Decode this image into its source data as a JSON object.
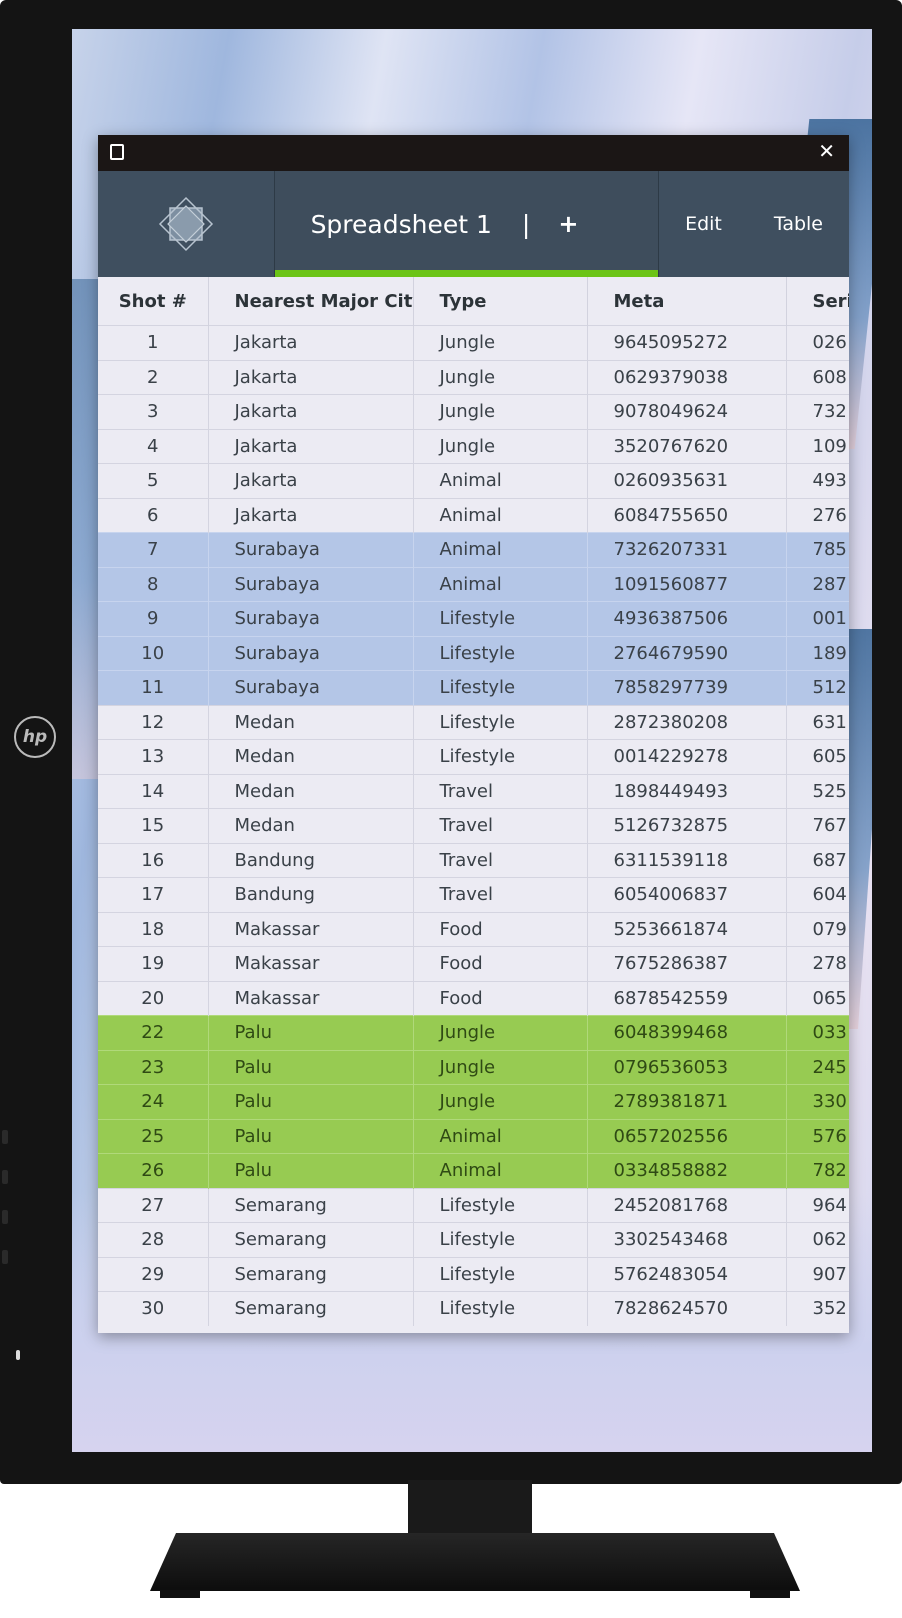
{
  "brand": {
    "logo_text": "hp"
  },
  "window": {
    "titlebar": {
      "maximize_icon": "square-icon",
      "close_icon": "close-icon",
      "close_label": "✕"
    },
    "app_logo_icon": "geometric-star-logo",
    "tab": {
      "title": "Spreadsheet 1",
      "separator": "|",
      "add": "+",
      "active_color": "#6cc417"
    },
    "menu": [
      "Edit",
      "Table"
    ]
  },
  "colors": {
    "header_bg": "#3f4f5f",
    "row_bg": "#ecebf3",
    "highlight_blue": "#b4c6e7",
    "highlight_green": "#97cb52"
  },
  "table": {
    "columns": [
      "Shot #",
      "Nearest Major City",
      "Type",
      "Meta",
      "Seri"
    ],
    "rows": [
      {
        "shot": "1",
        "city": "Jakarta",
        "type": "Jungle",
        "meta": "9645095272",
        "serial": "026",
        "hl": ""
      },
      {
        "shot": "2",
        "city": "Jakarta",
        "type": "Jungle",
        "meta": "0629379038",
        "serial": "608",
        "hl": ""
      },
      {
        "shot": "3",
        "city": "Jakarta",
        "type": "Jungle",
        "meta": "9078049624",
        "serial": "732",
        "hl": ""
      },
      {
        "shot": "4",
        "city": "Jakarta",
        "type": "Jungle",
        "meta": "3520767620",
        "serial": "109",
        "hl": ""
      },
      {
        "shot": "5",
        "city": "Jakarta",
        "type": "Animal",
        "meta": "0260935631",
        "serial": "493",
        "hl": ""
      },
      {
        "shot": "6",
        "city": "Jakarta",
        "type": "Animal",
        "meta": "6084755650",
        "serial": "276",
        "hl": ""
      },
      {
        "shot": "7",
        "city": "Surabaya",
        "type": "Animal",
        "meta": "7326207331",
        "serial": "785",
        "hl": "blue"
      },
      {
        "shot": "8",
        "city": "Surabaya",
        "type": "Animal",
        "meta": "1091560877",
        "serial": "287",
        "hl": "blue"
      },
      {
        "shot": "9",
        "city": "Surabaya",
        "type": "Lifestyle",
        "meta": "4936387506",
        "serial": "001",
        "hl": "blue"
      },
      {
        "shot": "10",
        "city": "Surabaya",
        "type": "Lifestyle",
        "meta": "2764679590",
        "serial": "189",
        "hl": "blue"
      },
      {
        "shot": "11",
        "city": "Surabaya",
        "type": "Lifestyle",
        "meta": "7858297739",
        "serial": "512",
        "hl": "blue"
      },
      {
        "shot": "12",
        "city": "Medan",
        "type": "Lifestyle",
        "meta": "2872380208",
        "serial": "631",
        "hl": ""
      },
      {
        "shot": "13",
        "city": "Medan",
        "type": "Lifestyle",
        "meta": "0014229278",
        "serial": "605",
        "hl": ""
      },
      {
        "shot": "14",
        "city": "Medan",
        "type": "Travel",
        "meta": "1898449493",
        "serial": "525",
        "hl": ""
      },
      {
        "shot": "15",
        "city": "Medan",
        "type": "Travel",
        "meta": "5126732875",
        "serial": "767",
        "hl": ""
      },
      {
        "shot": "16",
        "city": "Bandung",
        "type": "Travel",
        "meta": "6311539118",
        "serial": "687",
        "hl": ""
      },
      {
        "shot": "17",
        "city": "Bandung",
        "type": "Travel",
        "meta": "6054006837",
        "serial": "604",
        "hl": ""
      },
      {
        "shot": "18",
        "city": "Makassar",
        "type": "Food",
        "meta": "5253661874",
        "serial": "079",
        "hl": ""
      },
      {
        "shot": "19",
        "city": "Makassar",
        "type": "Food",
        "meta": "7675286387",
        "serial": "278",
        "hl": ""
      },
      {
        "shot": "20",
        "city": "Makassar",
        "type": "Food",
        "meta": "6878542559",
        "serial": "065",
        "hl": ""
      },
      {
        "shot": "22",
        "city": "Palu",
        "type": "Jungle",
        "meta": "6048399468",
        "serial": "033",
        "hl": "green"
      },
      {
        "shot": "23",
        "city": "Palu",
        "type": "Jungle",
        "meta": "0796536053",
        "serial": "245",
        "hl": "green"
      },
      {
        "shot": "24",
        "city": "Palu",
        "type": "Jungle",
        "meta": "2789381871",
        "serial": "330",
        "hl": "green"
      },
      {
        "shot": "25",
        "city": "Palu",
        "type": "Animal",
        "meta": "0657202556",
        "serial": "576",
        "hl": "green"
      },
      {
        "shot": "26",
        "city": "Palu",
        "type": "Animal",
        "meta": "0334858882",
        "serial": "782",
        "hl": "green"
      },
      {
        "shot": "27",
        "city": "Semarang",
        "type": "Lifestyle",
        "meta": "2452081768",
        "serial": "964",
        "hl": ""
      },
      {
        "shot": "28",
        "city": "Semarang",
        "type": "Lifestyle",
        "meta": "3302543468",
        "serial": "062",
        "hl": ""
      },
      {
        "shot": "29",
        "city": "Semarang",
        "type": "Lifestyle",
        "meta": "5762483054",
        "serial": "907",
        "hl": ""
      },
      {
        "shot": "30",
        "city": "Semarang",
        "type": "Lifestyle",
        "meta": "7828624570",
        "serial": "352",
        "hl": ""
      }
    ]
  }
}
